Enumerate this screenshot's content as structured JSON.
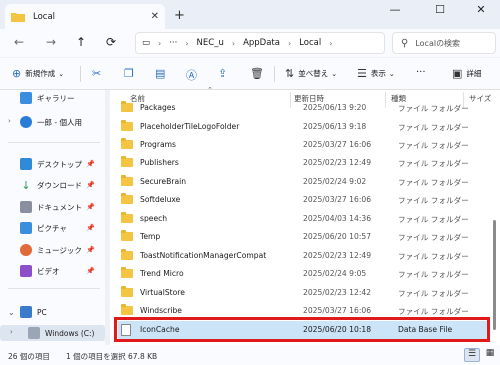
{
  "tab": {
    "title": "Local"
  },
  "window": {
    "minimize": "—",
    "maximize": "☐",
    "close": "✕"
  },
  "address": {
    "more": "···",
    "segments": [
      "NEC_u",
      "AppData",
      "Local"
    ],
    "search_placeholder": "Localの検索"
  },
  "toolbar": {
    "new_label": "新規作成",
    "sort_label": "並べ替え",
    "view_label": "表示",
    "more_label": "···",
    "details_label": "詳細"
  },
  "sidebar": {
    "items": [
      {
        "label": "ギャラリー",
        "icon": "gallery-icon"
      },
      {
        "label": "一郎 - 個人用",
        "icon": "cloud-icon"
      },
      {
        "label": "デスクトップ",
        "icon": "desktop-icon"
      },
      {
        "label": "ダウンロード",
        "icon": "download-icon"
      },
      {
        "label": "ドキュメント",
        "icon": "document-icon"
      },
      {
        "label": "ピクチャ",
        "icon": "pictures-icon"
      },
      {
        "label": "ミュージック",
        "icon": "music-icon"
      },
      {
        "label": "ビデオ",
        "icon": "video-icon"
      },
      {
        "label": "PC",
        "icon": "pc-icon"
      },
      {
        "label": "Windows (C:)",
        "icon": "drive-icon"
      }
    ]
  },
  "columns": {
    "name": "名前",
    "date": "更新日時",
    "type": "種類",
    "size": "サイズ"
  },
  "files": [
    {
      "name": "Packages",
      "date": "2025/06/13 9:20",
      "type": "ファイル フォルダー"
    },
    {
      "name": "PlaceholderTileLogoFolder",
      "date": "2025/06/13 9:18",
      "type": "ファイル フォルダー"
    },
    {
      "name": "Programs",
      "date": "2025/03/27 16:06",
      "type": "ファイル フォルダー"
    },
    {
      "name": "Publishers",
      "date": "2025/02/23 12:49",
      "type": "ファイル フォルダー"
    },
    {
      "name": "SecureBrain",
      "date": "2025/02/24 9:02",
      "type": "ファイル フォルダー"
    },
    {
      "name": "Softdeluxe",
      "date": "2025/03/27 16:06",
      "type": "ファイル フォルダー"
    },
    {
      "name": "speech",
      "date": "2025/04/03 14:36",
      "type": "ファイル フォルダー"
    },
    {
      "name": "Temp",
      "date": "2025/06/20 10:57",
      "type": "ファイル フォルダー"
    },
    {
      "name": "ToastNotificationManagerCompat",
      "date": "2025/02/23 12:49",
      "type": "ファイル フォルダー"
    },
    {
      "name": "Trend Micro",
      "date": "2025/02/24 9:05",
      "type": "ファイル フォルダー"
    },
    {
      "name": "VirtualStore",
      "date": "2025/02/23 12:42",
      "type": "ファイル フォルダー"
    },
    {
      "name": "Windscribe",
      "date": "2025/03/27 16:06",
      "type": "ファイル フォルダー"
    },
    {
      "name": "IconCache",
      "date": "2025/06/20 10:18",
      "type": "Data Base File",
      "selected": true
    }
  ],
  "status": {
    "count": "26 個の項目",
    "selection": "1 個の項目を選択  67.8 KB"
  }
}
